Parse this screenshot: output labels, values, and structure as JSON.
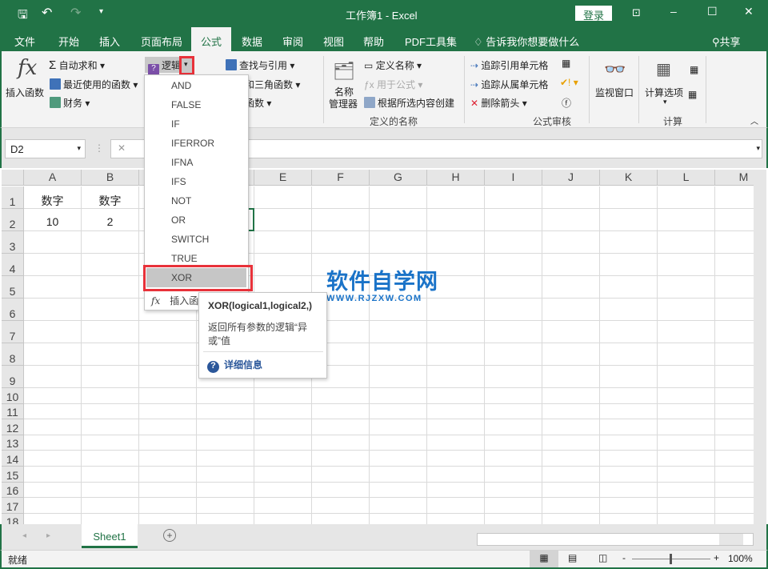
{
  "title_bar": {
    "title": "工作簿1  -  Excel",
    "login": "登录",
    "quick_access": [
      "save-icon",
      "undo-icon",
      "redo-icon",
      "customize-icon"
    ]
  },
  "tabs": [
    {
      "label": "文件"
    },
    {
      "label": "开始"
    },
    {
      "label": "插入"
    },
    {
      "label": "页面布局"
    },
    {
      "label": "公式",
      "active": true
    },
    {
      "label": "数据"
    },
    {
      "label": "审阅"
    },
    {
      "label": "视图"
    },
    {
      "label": "帮助"
    },
    {
      "label": "PDF工具集"
    }
  ],
  "tell_me": "告诉我你想要做什么",
  "share": "共享",
  "ribbon": {
    "function_library": {
      "insert_function": "插入函数",
      "autosum": "自动求和",
      "recent": "最近使用的函数",
      "financial": "财务",
      "logical": "逻辑",
      "lookup": "查找与引用",
      "math": "数学和三角函数",
      "other": "其他函数"
    },
    "defined_names": {
      "name_manager_1": "名称",
      "name_manager_2": "管理器",
      "define_name": "定义名称",
      "use_in_formula": "用于公式",
      "create_from_selection": "根据所选内容创建",
      "group": "定义的名称"
    },
    "formula_auditing": {
      "trace_precedents": "追踪引用单元格",
      "trace_dependents": "追踪从属单元格",
      "remove_arrows": "删除箭头",
      "group": "公式审核"
    },
    "watch_window": "监视窗口",
    "calculation": {
      "options": "计算选项",
      "group": "计算"
    }
  },
  "formula_bar": {
    "name_box": "D2",
    "formula": ""
  },
  "columns": [
    "A",
    "B",
    "C",
    "D",
    "E",
    "F",
    "G",
    "H",
    "I",
    "J",
    "K",
    "L",
    "M"
  ],
  "rows": [
    "1",
    "2",
    "3",
    "4",
    "5",
    "6",
    "7",
    "8",
    "9",
    "10",
    "11",
    "12",
    "13",
    "14",
    "15",
    "16",
    "17",
    "18"
  ],
  "cells": {
    "A1": "数字",
    "B1": "数字",
    "A2": "10",
    "B2": "2"
  },
  "selected_cell": "D2",
  "logical_menu": {
    "items": [
      "AND",
      "FALSE",
      "IF",
      "IFERROR",
      "IFNA",
      "IFS",
      "NOT",
      "OR",
      "SWITCH",
      "TRUE",
      "XOR"
    ],
    "highlighted": "XOR",
    "insert_function": "插入函数..."
  },
  "tooltip": {
    "signature": "XOR(logical1,logical2,)",
    "description": "返回所有参数的逻辑“异或”值",
    "more_info": "详细信息"
  },
  "watermark": {
    "text": "软件自学网",
    "url": "WWW.RJZXW.COM"
  },
  "sheet_tabs": [
    {
      "label": "Sheet1",
      "active": true
    }
  ],
  "status": {
    "ready": "就绪",
    "zoom": "100%",
    "zoom_level_percent": 100
  },
  "colors": {
    "brand": "#217346",
    "highlight_box": "#e8323a",
    "watermark": "#1a73c8"
  }
}
